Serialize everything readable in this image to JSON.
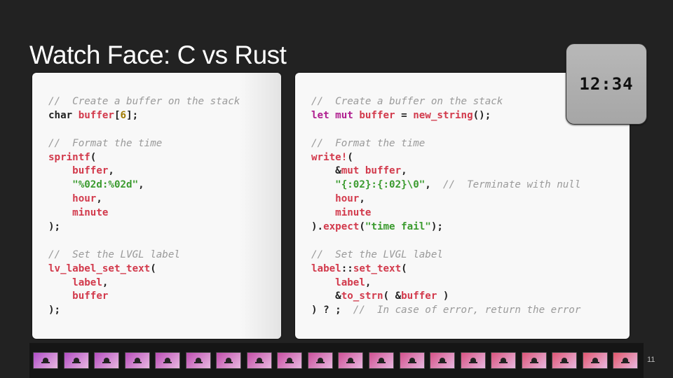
{
  "slide": {
    "title": "Watch Face: C vs Rust",
    "page_number": "11"
  },
  "clock": {
    "time": "12:34"
  },
  "code_c": {
    "lines": [
      [
        {
          "t": "//  Create a buffer on the stack",
          "c": "cm"
        }
      ],
      [
        {
          "t": "char ",
          "c": "pl"
        },
        {
          "t": "buffer",
          "c": "fn"
        },
        {
          "t": "[",
          "c": "pl"
        },
        {
          "t": "6",
          "c": "num"
        },
        {
          "t": "];",
          "c": "pl"
        }
      ],
      [],
      [
        {
          "t": "//  Format the time",
          "c": "cm"
        }
      ],
      [
        {
          "t": "sprintf",
          "c": "fn"
        },
        {
          "t": "(",
          "c": "pl"
        }
      ],
      [
        {
          "t": "    ",
          "c": "pl"
        },
        {
          "t": "buffer",
          "c": "fn"
        },
        {
          "t": ",",
          "c": "pl"
        }
      ],
      [
        {
          "t": "    ",
          "c": "pl"
        },
        {
          "t": "\"%02d:%02d\"",
          "c": "str"
        },
        {
          "t": ",",
          "c": "pl"
        }
      ],
      [
        {
          "t": "    ",
          "c": "pl"
        },
        {
          "t": "hour",
          "c": "fn"
        },
        {
          "t": ",",
          "c": "pl"
        }
      ],
      [
        {
          "t": "    ",
          "c": "pl"
        },
        {
          "t": "minute",
          "c": "fn"
        }
      ],
      [
        {
          "t": ");",
          "c": "pl"
        }
      ],
      [],
      [
        {
          "t": "//  Set the LVGL label",
          "c": "cm"
        }
      ],
      [
        {
          "t": "lv_label_set_text",
          "c": "fn"
        },
        {
          "t": "(",
          "c": "pl"
        }
      ],
      [
        {
          "t": "    ",
          "c": "pl"
        },
        {
          "t": "label",
          "c": "fn"
        },
        {
          "t": ",",
          "c": "pl"
        }
      ],
      [
        {
          "t": "    ",
          "c": "pl"
        },
        {
          "t": "buffer",
          "c": "fn"
        }
      ],
      [
        {
          "t": ");",
          "c": "pl"
        }
      ]
    ]
  },
  "code_rust": {
    "lines": [
      [
        {
          "t": "//  Create a buffer on the stack",
          "c": "cm"
        }
      ],
      [
        {
          "t": "let mut ",
          "c": "kw"
        },
        {
          "t": "buffer",
          "c": "fn"
        },
        {
          "t": " = ",
          "c": "pl"
        },
        {
          "t": "new_string",
          "c": "fn"
        },
        {
          "t": "();",
          "c": "pl"
        }
      ],
      [],
      [
        {
          "t": "//  Format the time",
          "c": "cm"
        }
      ],
      [
        {
          "t": "write!",
          "c": "fn"
        },
        {
          "t": "(",
          "c": "pl"
        }
      ],
      [
        {
          "t": "    ",
          "c": "pl"
        },
        {
          "t": "&",
          "c": "pl"
        },
        {
          "t": "mut ",
          "c": "fn"
        },
        {
          "t": "buffer",
          "c": "fn"
        },
        {
          "t": ",",
          "c": "pl"
        }
      ],
      [
        {
          "t": "    ",
          "c": "pl"
        },
        {
          "t": "\"{:02}:{:02}\\0\"",
          "c": "str"
        },
        {
          "t": ",  ",
          "c": "pl"
        },
        {
          "t": "//  Terminate with null",
          "c": "cm"
        }
      ],
      [
        {
          "t": "    ",
          "c": "pl"
        },
        {
          "t": "hour",
          "c": "fn"
        },
        {
          "t": ",",
          "c": "pl"
        }
      ],
      [
        {
          "t": "    ",
          "c": "pl"
        },
        {
          "t": "minute",
          "c": "fn"
        }
      ],
      [
        {
          "t": ").",
          "c": "pl"
        },
        {
          "t": "expect",
          "c": "fn"
        },
        {
          "t": "(",
          "c": "pl"
        },
        {
          "t": "\"time fail\"",
          "c": "str"
        },
        {
          "t": ");",
          "c": "pl"
        }
      ],
      [],
      [
        {
          "t": "//  Set the LVGL label",
          "c": "cm"
        }
      ],
      [
        {
          "t": "label",
          "c": "fn"
        },
        {
          "t": "::",
          "c": "pl"
        },
        {
          "t": "set_text",
          "c": "fn"
        },
        {
          "t": "(",
          "c": "pl"
        }
      ],
      [
        {
          "t": "    ",
          "c": "pl"
        },
        {
          "t": "label",
          "c": "fn"
        },
        {
          "t": ",",
          "c": "pl"
        }
      ],
      [
        {
          "t": "    ",
          "c": "pl"
        },
        {
          "t": "&",
          "c": "pl"
        },
        {
          "t": "to_strn",
          "c": "fn"
        },
        {
          "t": "( &",
          "c": "pl"
        },
        {
          "t": "buffer",
          "c": "fn"
        },
        {
          "t": " )",
          "c": "pl"
        }
      ],
      [
        {
          "t": ") ? ;  ",
          "c": "pl"
        },
        {
          "t": "//  In case of error, return the error",
          "c": "cm"
        }
      ]
    ]
  },
  "filmstrip": {
    "thumbnails": [
      {
        "color": "#b04ec8"
      },
      {
        "color": "#b24dc4"
      },
      {
        "color": "#b54dc0"
      },
      {
        "color": "#b84dbb"
      },
      {
        "color": "#bb4db6"
      },
      {
        "color": "#be4db1"
      },
      {
        "color": "#c14dab"
      },
      {
        "color": "#c44ea6"
      },
      {
        "color": "#c74ea1"
      },
      {
        "color": "#ca4f9b"
      },
      {
        "color": "#cd5096"
      },
      {
        "color": "#cf5091"
      },
      {
        "color": "#d2518c"
      },
      {
        "color": "#d55287"
      },
      {
        "color": "#d75382"
      },
      {
        "color": "#d9547d"
      },
      {
        "color": "#dc5578"
      },
      {
        "color": "#de5674"
      },
      {
        "color": "#e05770"
      },
      {
        "color": "#e2586c"
      }
    ]
  }
}
